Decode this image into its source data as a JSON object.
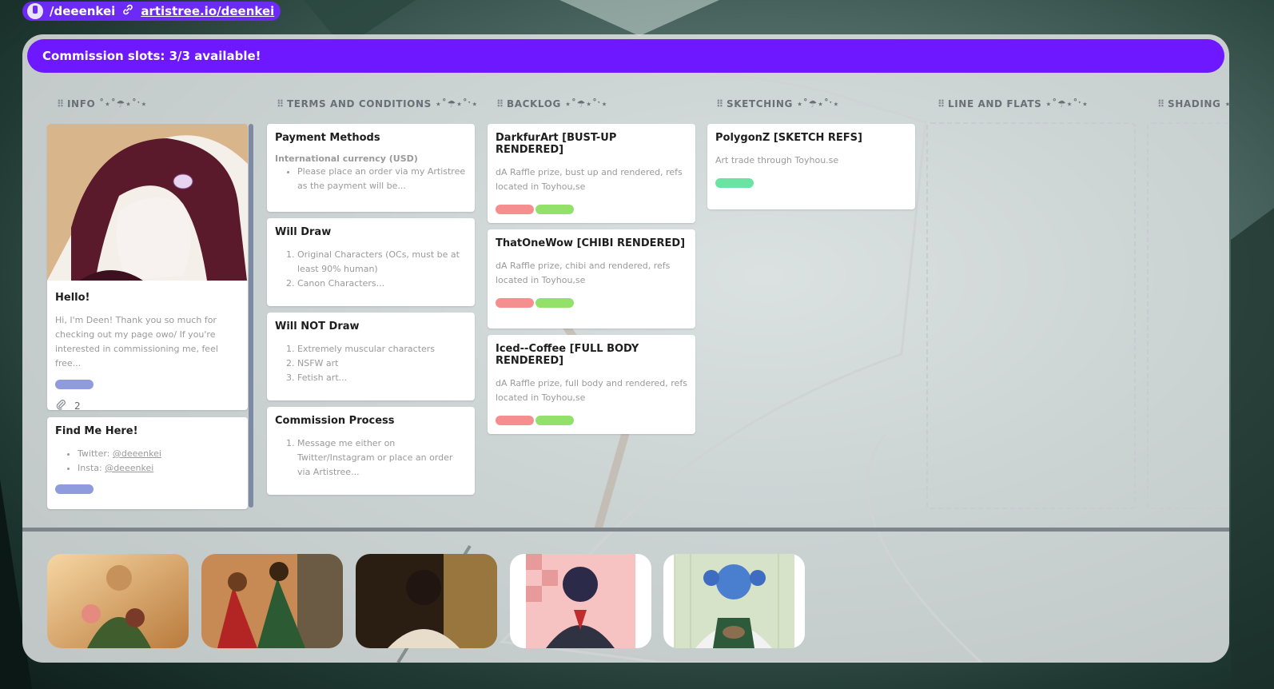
{
  "topbar": {
    "handle": "/deeenkei",
    "url": "artistree.io/deenkei"
  },
  "banner": {
    "text": "Commission slots: 3/3 available!"
  },
  "columns": [
    {
      "title": "INFO ˚⋆˚☂⋆˚ˑ⋆"
    },
    {
      "title": "TERMS AND CONDITIONS ⋆˚☂⋆˚ˑ⋆"
    },
    {
      "title": "BACKLOG ⋆˚☂⋆˚ˑ⋆"
    },
    {
      "title": "SKETCHING ⋆˚☂⋆˚ˑ⋆"
    },
    {
      "title": "LINE AND FLATS ⋆˚☂⋆˚ˑ⋆"
    },
    {
      "title": "SHADING ⋆˚"
    }
  ],
  "info": {
    "hello": {
      "title": "Hello!",
      "desc": "Hi, I'm Deen! Thank you so much for checking out my page owo/ If you're interested in commissioning me, feel free...",
      "attachments": "2"
    },
    "find": {
      "title": "Find Me Here!",
      "items": [
        {
          "label": "Twitter: ",
          "handle": "@deeenkei"
        },
        {
          "label": "Insta: ",
          "handle": "@deeenkei"
        }
      ]
    }
  },
  "terms": [
    {
      "title": "Payment Methods",
      "sub": "International currency (USD)",
      "items": [
        "Please place an order via my Artistree as the payment will be..."
      ]
    },
    {
      "title": "Will Draw",
      "items": [
        "Original Characters (OCs, must be at least 90% human)",
        "Canon Characters..."
      ]
    },
    {
      "title": "Will NOT Draw",
      "items": [
        "Extremely muscular characters",
        "NSFW art",
        "Fetish art..."
      ]
    },
    {
      "title": "Commission Process",
      "items": [
        "Message me either on Twitter/Instagram or place an order via Artistree..."
      ]
    }
  ],
  "backlog": [
    {
      "title": "DarkfurArt [BUST-UP RENDERED]",
      "desc": "dA Raffle prize, bust up and rendered, refs located in Toyhou,se"
    },
    {
      "title": "ThatOneWow [CHIBI RENDERED]",
      "desc": "dA Raffle prize, chibi and rendered, refs located in Toyhou,se"
    },
    {
      "title": "Iced--Coffee [FULL BODY RENDERED]",
      "desc": "dA Raffle prize, full body and rendered, refs located in Toyhou,se"
    }
  ],
  "sketching": [
    {
      "title": "PolygonZ [SKETCH REFS]",
      "desc": "Art trade through Toyhou.se"
    }
  ],
  "colors": {
    "accent": "#6d18ff",
    "label_blue": "#8f9bdc",
    "label_red": "#f58e8e",
    "label_green": "#93e06b",
    "label_teal": "#6be3a2"
  }
}
